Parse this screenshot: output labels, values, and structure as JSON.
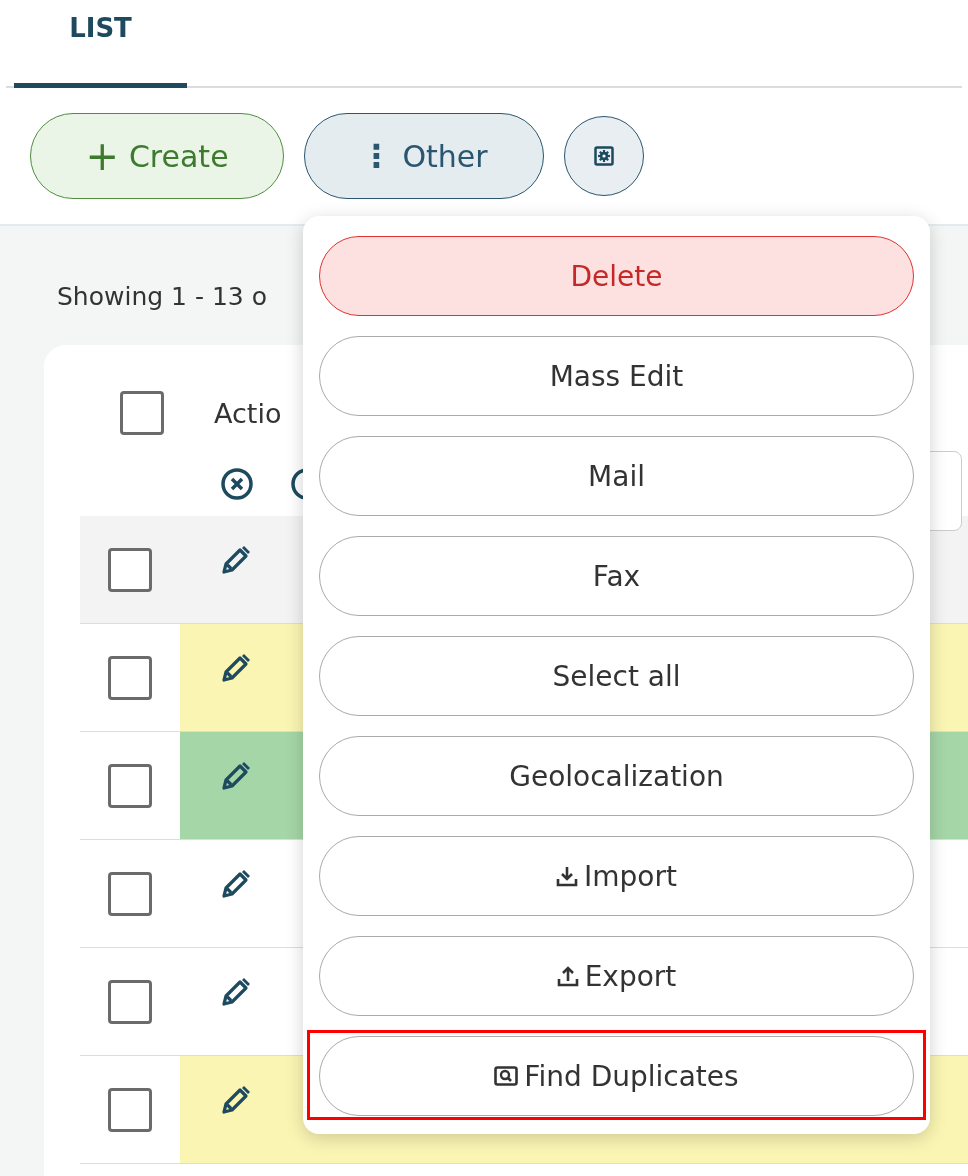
{
  "tabs": [
    {
      "label": "LIST",
      "selected": true
    }
  ],
  "toolbar": {
    "create": {
      "icon_text": "+",
      "label": "Create"
    },
    "other": {
      "icon_text": "⋮",
      "label": "Other",
      "expanded": true
    }
  },
  "summary": "Showing 1 - 13 o",
  "table": {
    "header": {
      "checked": false,
      "label": "Actio"
    },
    "rows": [
      {
        "checked": false,
        "hovered": true
      },
      {
        "checked": false,
        "hovered": false,
        "color": "#fbf5b3"
      },
      {
        "checked": false,
        "hovered": false,
        "color": "#a5d6a7"
      },
      {
        "checked": false,
        "hovered": false
      },
      {
        "checked": false,
        "hovered": false
      },
      {
        "checked": false,
        "hovered": false,
        "color": "#fbf5b3"
      }
    ]
  },
  "menu": {
    "items": [
      {
        "label": "Delete",
        "kind": "danger",
        "highlighted": false
      },
      {
        "label": "Mass Edit",
        "kind": "plain",
        "highlighted": false
      },
      {
        "label": "Mail",
        "kind": "plain",
        "highlighted": false
      },
      {
        "label": "Fax",
        "kind": "plain",
        "highlighted": false
      },
      {
        "label": "Select all",
        "kind": "plain",
        "highlighted": false
      },
      {
        "label": "Geolocalization",
        "kind": "plain",
        "highlighted": false
      },
      {
        "label": "Import",
        "kind": "import",
        "highlighted": false
      },
      {
        "label": "Export",
        "kind": "export",
        "highlighted": false
      },
      {
        "label": "Find Duplicates",
        "kind": "find",
        "highlighted": true
      }
    ]
  }
}
